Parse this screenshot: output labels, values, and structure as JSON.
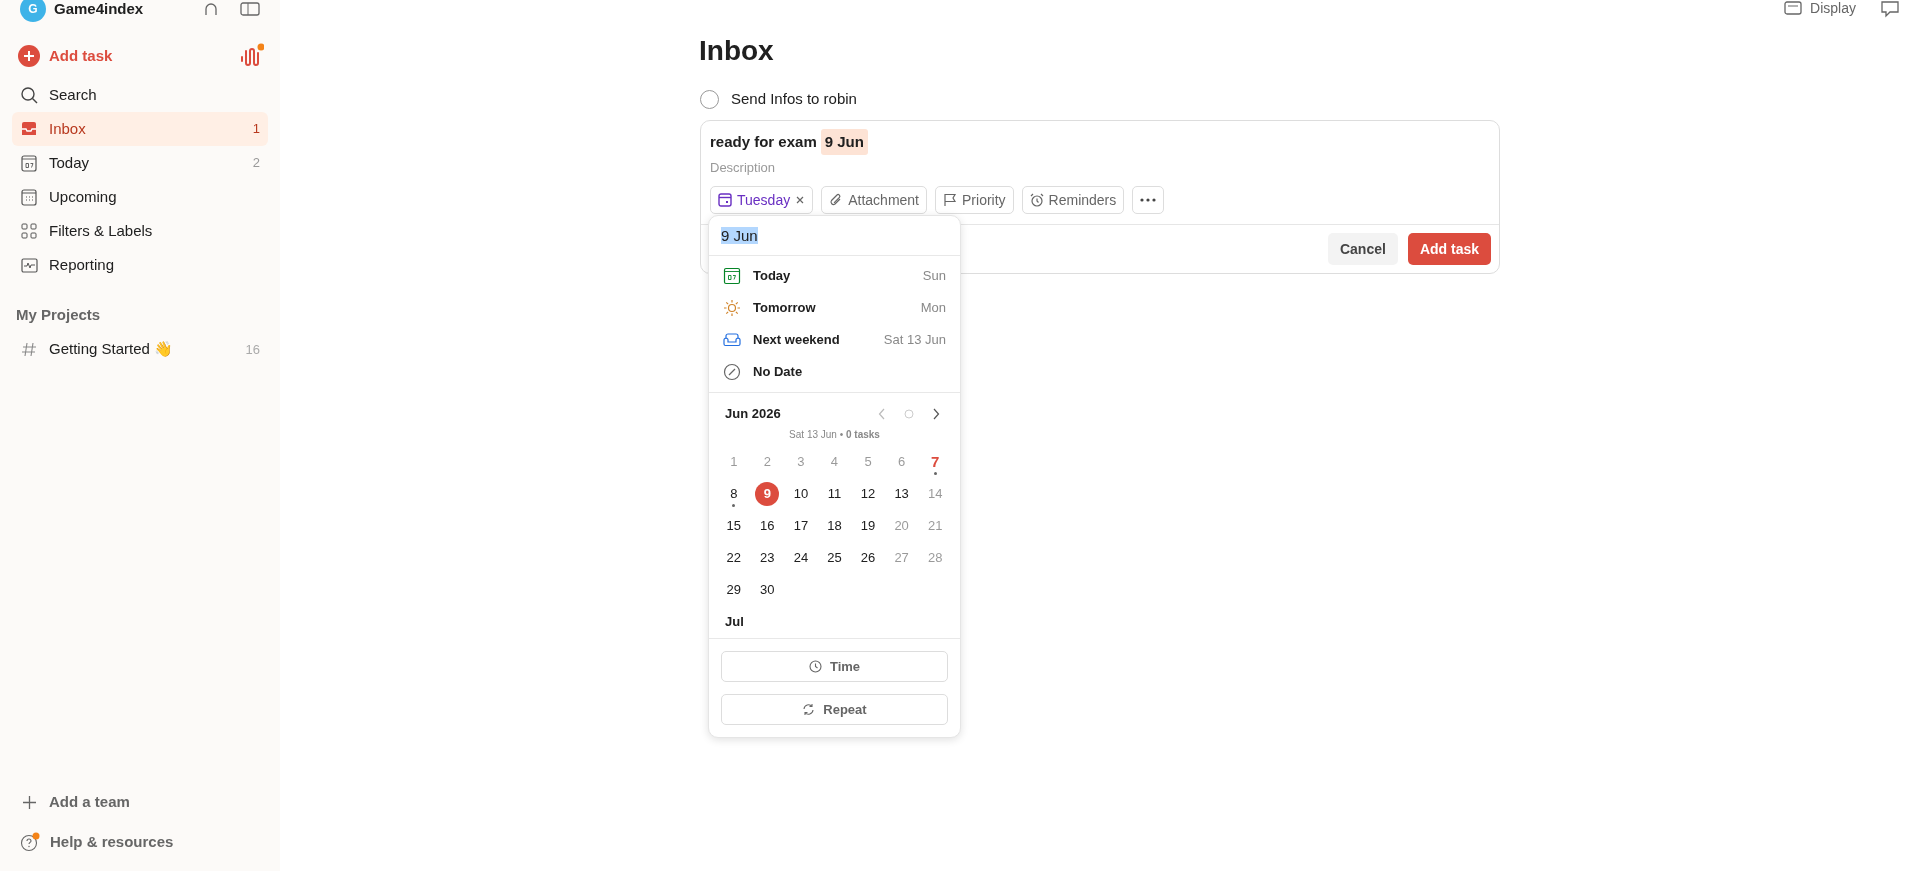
{
  "workspace": {
    "name": "Game4index",
    "avatar": "G"
  },
  "sidebar": {
    "add_task": "Add task",
    "items": [
      {
        "kind": "search",
        "label": "Search",
        "selected": false
      },
      {
        "kind": "inbox",
        "label": "Inbox",
        "count": "1",
        "selected": true
      },
      {
        "kind": "today",
        "label": "Today",
        "count": "2",
        "selected": false
      },
      {
        "kind": "upcoming",
        "label": "Upcoming",
        "selected": false
      },
      {
        "kind": "filters",
        "label": "Filters & Labels",
        "selected": false
      },
      {
        "kind": "reporting",
        "label": "Reporting",
        "selected": false
      }
    ],
    "projects_heading": "My Projects",
    "projects": [
      {
        "label": "Getting Started 👋",
        "count": "16"
      }
    ],
    "footer": [
      {
        "kind": "add",
        "label": "Add a team"
      },
      {
        "kind": "help",
        "label": "Help & resources"
      }
    ]
  },
  "toolbar": {
    "display": "Display"
  },
  "page": {
    "title": "Inbox",
    "tasks": [
      {
        "title": "Send Infos to robin",
        "checked": false
      }
    ],
    "editor": {
      "title": "ready for exam",
      "date_token": "9 Jun",
      "description_placeholder": "Description",
      "chips": [
        {
          "kind": "date",
          "label": "Tuesday"
        },
        {
          "kind": "attachment",
          "label": "Attachment"
        },
        {
          "kind": "priority",
          "label": "Priority"
        },
        {
          "kind": "reminders",
          "label": "Reminders"
        },
        {
          "kind": "more"
        }
      ],
      "cancel": "Cancel",
      "submit": "Add task"
    },
    "date_picker": {
      "input": "9 Jun",
      "quick": [
        {
          "kind": "today",
          "label": "Today",
          "hint": "Sun"
        },
        {
          "kind": "tomorrow",
          "label": "Tomorrow",
          "hint": "Mon"
        },
        {
          "kind": "weekend",
          "label": "Next weekend",
          "hint": "Sat 13 Jun"
        },
        {
          "kind": "none",
          "label": "No Date"
        }
      ],
      "month": "Jun 2026",
      "summary": "Sat 13 Jun • **0 tasks**",
      "days": [
        {
          "label": "1",
          "muted": true,
          "selected": false,
          "today": false,
          "dot": false
        },
        {
          "label": "2",
          "muted": true,
          "selected": false,
          "today": false,
          "dot": false
        },
        {
          "label": "3",
          "muted": true,
          "selected": false,
          "today": false,
          "dot": false
        },
        {
          "label": "4",
          "muted": true,
          "selected": false,
          "today": false,
          "dot": false
        },
        {
          "label": "5",
          "muted": true,
          "selected": false,
          "today": false,
          "dot": false
        },
        {
          "label": "6",
          "muted": true,
          "selected": false,
          "today": false,
          "dot": false
        },
        {
          "label": "7",
          "muted": false,
          "selected": false,
          "today": true,
          "dot": true
        },
        {
          "label": "8",
          "muted": false,
          "selected": false,
          "today": false,
          "dot": true
        },
        {
          "label": "9",
          "muted": false,
          "selected": true,
          "today": false,
          "dot": false
        },
        {
          "label": "10",
          "muted": false,
          "selected": false,
          "today": false,
          "dot": false
        },
        {
          "label": "11",
          "muted": false,
          "selected": false,
          "today": false,
          "dot": false
        },
        {
          "label": "12",
          "muted": false,
          "selected": false,
          "today": false,
          "dot": false
        },
        {
          "label": "13",
          "muted": false,
          "selected": false,
          "today": false,
          "dot": false
        },
        {
          "label": "14",
          "muted": true,
          "selected": false,
          "today": false,
          "dot": false
        },
        {
          "label": "15",
          "muted": false,
          "selected": false,
          "today": false,
          "dot": false
        },
        {
          "label": "16",
          "muted": false,
          "selected": false,
          "today": false,
          "dot": false
        },
        {
          "label": "17",
          "muted": false,
          "selected": false,
          "today": false,
          "dot": false
        },
        {
          "label": "18",
          "muted": false,
          "selected": false,
          "today": false,
          "dot": false
        },
        {
          "label": "19",
          "muted": false,
          "selected": false,
          "today": false,
          "dot": false
        },
        {
          "label": "20",
          "muted": true,
          "selected": false,
          "today": false,
          "dot": false
        },
        {
          "label": "21",
          "muted": true,
          "selected": false,
          "today": false,
          "dot": false
        },
        {
          "label": "22",
          "muted": false,
          "selected": false,
          "today": false,
          "dot": false
        },
        {
          "label": "23",
          "muted": false,
          "selected": false,
          "today": false,
          "dot": false
        },
        {
          "label": "24",
          "muted": false,
          "selected": false,
          "today": false,
          "dot": false
        },
        {
          "label": "25",
          "muted": false,
          "selected": false,
          "today": false,
          "dot": false
        },
        {
          "label": "26",
          "muted": false,
          "selected": false,
          "today": false,
          "dot": false
        },
        {
          "label": "27",
          "muted": true,
          "selected": false,
          "today": false,
          "dot": false
        },
        {
          "label": "28",
          "muted": true,
          "selected": false,
          "today": false,
          "dot": false
        },
        {
          "label": "29",
          "muted": false,
          "selected": false,
          "today": false,
          "dot": false
        },
        {
          "label": "30",
          "muted": false,
          "selected": false,
          "today": false,
          "dot": false
        }
      ],
      "next_month": "Jul",
      "buttons": [
        {
          "kind": "time",
          "label": "Time"
        },
        {
          "kind": "repeat",
          "label": "Repeat"
        }
      ]
    }
  }
}
